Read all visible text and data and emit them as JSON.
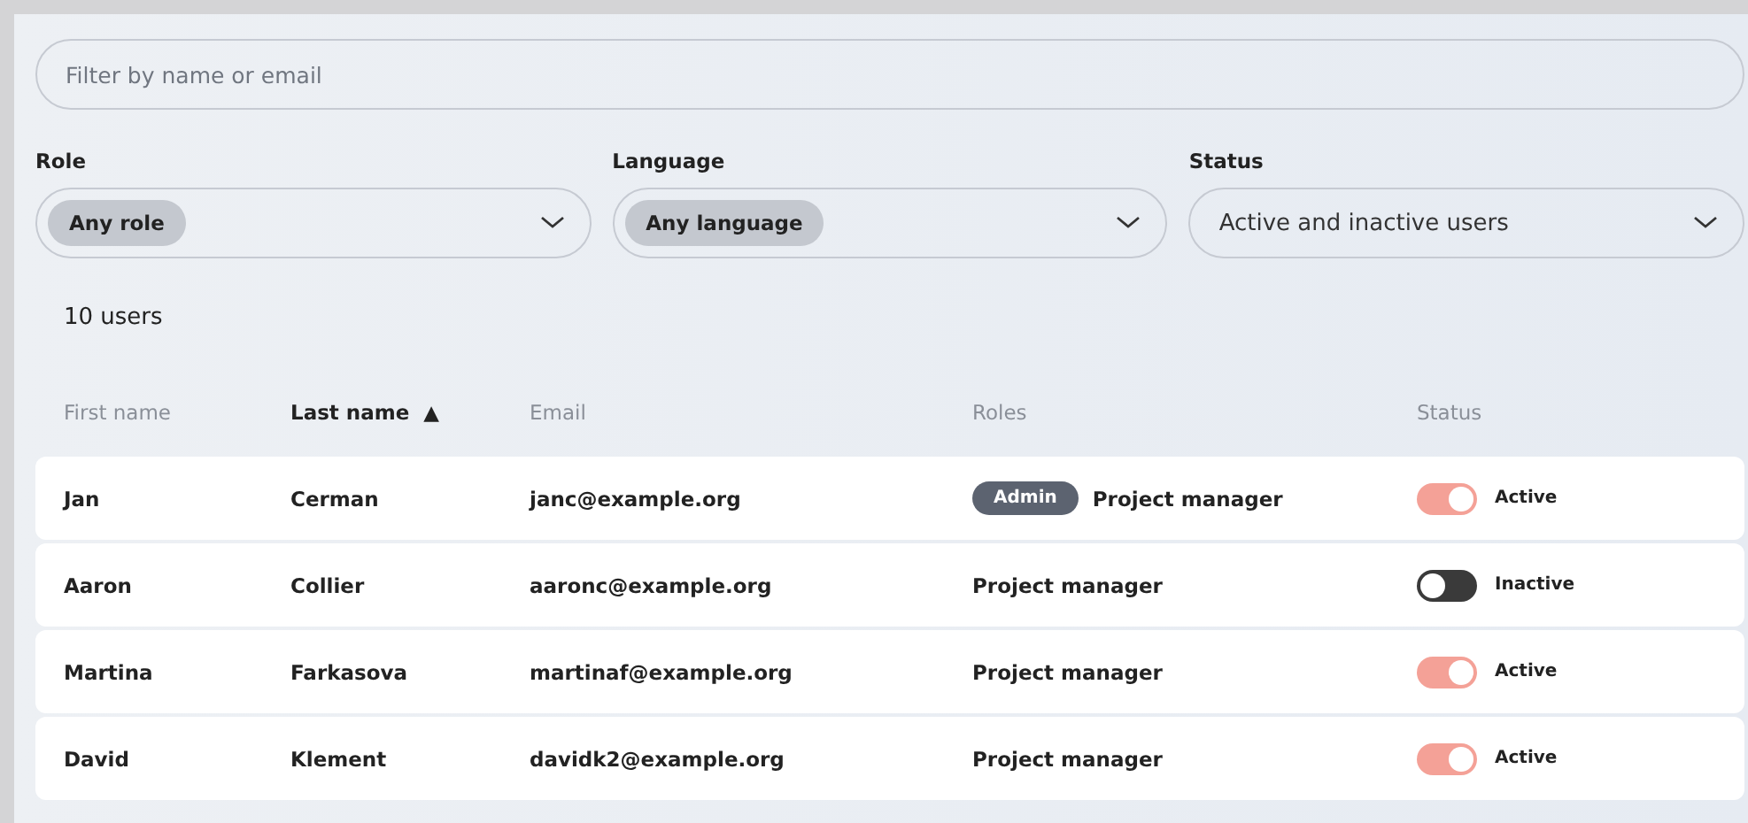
{
  "search": {
    "placeholder": "Filter by name or email"
  },
  "filters": [
    {
      "label": "Role",
      "value": "Any role",
      "chip": true
    },
    {
      "label": "Language",
      "value": "Any language",
      "chip": true
    },
    {
      "label": "Status",
      "value": "Active and inactive users",
      "chip": false
    }
  ],
  "user_count": "10 users",
  "table": {
    "columns": [
      {
        "label": "First name",
        "sorted": false
      },
      {
        "label": "Last name",
        "sorted": true,
        "sort_icon": "▲"
      },
      {
        "label": "Email",
        "sorted": false
      },
      {
        "label": "Roles",
        "sorted": false
      },
      {
        "label": "Status",
        "sorted": false
      }
    ],
    "rows": [
      {
        "first_name": "Jan",
        "last_name": "Cerman",
        "email": "janc@example.org",
        "roles": [
          {
            "kind": "badge",
            "label": "Admin"
          },
          {
            "kind": "text",
            "label": "Project manager"
          }
        ],
        "active": true,
        "status": "Active"
      },
      {
        "first_name": "Aaron",
        "last_name": "Collier",
        "email": "aaronc@example.org",
        "roles": [
          {
            "kind": "text",
            "label": "Project manager"
          }
        ],
        "active": false,
        "status": "Inactive"
      },
      {
        "first_name": "Martina",
        "last_name": "Farkasova",
        "email": "martinaf@example.org",
        "roles": [
          {
            "kind": "text",
            "label": "Project manager"
          }
        ],
        "active": true,
        "status": "Active"
      },
      {
        "first_name": "David",
        "last_name": "Klement",
        "email": "davidk2@example.org",
        "roles": [
          {
            "kind": "text",
            "label": "Project manager"
          }
        ],
        "active": true,
        "status": "Active"
      }
    ]
  }
}
